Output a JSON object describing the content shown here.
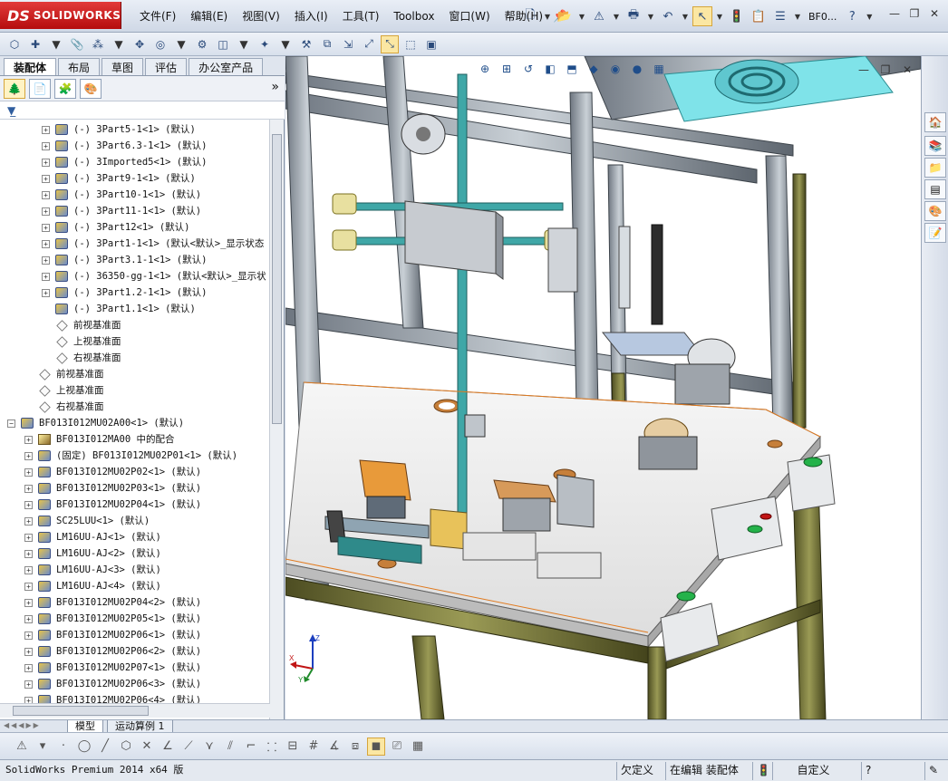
{
  "app": {
    "brand_ds": "DS",
    "brand_name": "SOLIDWORKS"
  },
  "menu": [
    {
      "label": "文件(F)"
    },
    {
      "label": "编辑(E)"
    },
    {
      "label": "视图(V)"
    },
    {
      "label": "插入(I)"
    },
    {
      "label": "工具(T)"
    },
    {
      "label": "Toolbox"
    },
    {
      "label": "窗口(W)"
    },
    {
      "label": "帮助(H)"
    }
  ],
  "title": {
    "document": "BF0...",
    "help": "?"
  },
  "left_tabs": [
    "装配体",
    "布局",
    "草图",
    "评估",
    "办公室产品"
  ],
  "tree_more": "»",
  "tree": [
    {
      "label": "(-) 3Part5-1<1> (默认)"
    },
    {
      "label": "(-) 3Part6.3-1<1> (默认)"
    },
    {
      "label": "(-) 3Imported5<1> (默认)"
    },
    {
      "label": "(-) 3Part9-1<1> (默认)"
    },
    {
      "label": "(-) 3Part10-1<1> (默认)"
    },
    {
      "label": "(-) 3Part11-1<1> (默认)"
    },
    {
      "label": "(-) 3Part12<1> (默认)"
    },
    {
      "label": "(-) 3Part1-1<1> (默认<默认>_显示状态"
    },
    {
      "label": "(-) 3Part3.1-1<1> (默认)"
    },
    {
      "label": "(-) 36350-gg-1<1> (默认<默认>_显示状"
    },
    {
      "label": "(-) 3Part1.2-1<1> (默认)"
    },
    {
      "label": "(-) 3Part1.1<1> (默认)"
    },
    {
      "label": "前视基准面"
    },
    {
      "label": "上视基准面"
    },
    {
      "label": "右视基准面"
    },
    {
      "label": "前视基准面"
    },
    {
      "label": "上视基准面"
    },
    {
      "label": "右视基准面"
    },
    {
      "label": "BF013I012MU02A00<1> (默认)"
    },
    {
      "label": "BF013I012MA00 中的配合"
    },
    {
      "label": "(固定) BF013I012MU02P01<1> (默认)"
    },
    {
      "label": "BF013I012MU02P02<1> (默认)"
    },
    {
      "label": "BF013I012MU02P03<1> (默认)"
    },
    {
      "label": "BF013I012MU02P04<1> (默认)"
    },
    {
      "label": "SC25LUU<1> (默认)"
    },
    {
      "label": "LM16UU-AJ<1> (默认)"
    },
    {
      "label": "LM16UU-AJ<2> (默认)"
    },
    {
      "label": "LM16UU-AJ<3> (默认)"
    },
    {
      "label": "LM16UU-AJ<4> (默认)"
    },
    {
      "label": "BF013I012MU02P04<2> (默认)"
    },
    {
      "label": "BF013I012MU02P05<1> (默认)"
    },
    {
      "label": "BF013I012MU02P06<1> (默认)"
    },
    {
      "label": "BF013I012MU02P06<2> (默认)"
    },
    {
      "label": "BF013I012MU02P07<1> (默认)"
    },
    {
      "label": "BF013I012MU02P06<3> (默认)"
    },
    {
      "label": "BF013I012MU02P06<4> (默认)"
    }
  ],
  "bottom_tabs": [
    "模型",
    "运动算例 1"
  ],
  "triad": {
    "x": "X",
    "y": "Y",
    "z": "Z"
  },
  "status": {
    "product": "SolidWorks Premium 2014 x64 版",
    "state": "欠定义",
    "mode": "在编辑 装配体",
    "custom": "自定义"
  },
  "colors": {
    "frame_aluminum": "#9aa3ad",
    "base_frame": "#7a7a3a",
    "teal_guide": "#3fa7a7",
    "cyan_fan": "#7fe3e9",
    "accent_red": "#c11515"
  }
}
